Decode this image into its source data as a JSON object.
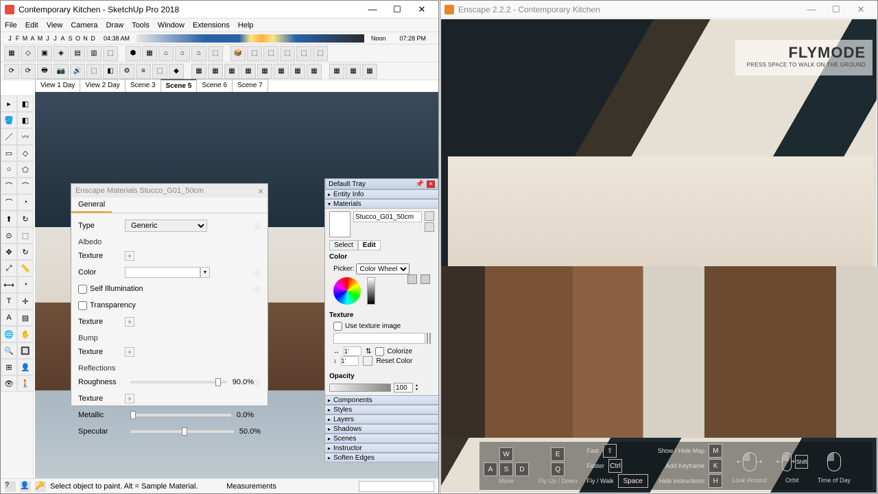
{
  "sketchup": {
    "title": "Contemporary Kitchen - SketchUp Pro 2018",
    "menu": [
      "File",
      "Edit",
      "View",
      "Camera",
      "Draw",
      "Tools",
      "Window",
      "Extensions",
      "Help"
    ],
    "months": [
      "J",
      "F",
      "M",
      "A",
      "M",
      "J",
      "J",
      "A",
      "S",
      "O",
      "N",
      "D"
    ],
    "time_04": "04:38 AM",
    "time_noon": "Noon",
    "time_pm": "07:28 PM",
    "scenes": {
      "list": [
        "View 1 Day",
        "View 2 Day",
        "Scene 3",
        "Scene 5",
        "Scene 6",
        "Scene 7"
      ],
      "active": "Scene 5"
    },
    "status_hint": "Select object to paint. Alt = Sample Material.",
    "measurements_label": "Measurements"
  },
  "enscape_mat": {
    "title": "Enscape Materials Stucco_G01_50cm",
    "tab": "General",
    "type_label": "Type",
    "type_value": "Generic",
    "albedo": "Albedo",
    "texture": "Texture",
    "color": "Color",
    "self_illum": "Self Illumination",
    "transparency": "Transparency",
    "bump": "Bump",
    "reflections": "Reflections",
    "roughness": "Roughness",
    "roughness_val": "90.0%",
    "metallic": "Metallic",
    "metallic_val": "0.0%",
    "specular": "Specular",
    "specular_val": "50.0%"
  },
  "tray": {
    "title": "Default Tray",
    "entity_info": "Entity Info",
    "materials": "Materials",
    "material_name": "Stucco_G01_50cm",
    "select": "Select",
    "edit": "Edit",
    "color": "Color",
    "picker_label": "Picker:",
    "picker_value": "Color Wheel",
    "texture": "Texture",
    "use_tex": "Use texture image",
    "colorize": "Colorize",
    "reset_color": "Reset Color",
    "opacity": "Opacity",
    "opacity_val": "100",
    "sections": [
      "Components",
      "Styles",
      "Layers",
      "Shadows",
      "Scenes",
      "Instructor",
      "Soften Edges"
    ]
  },
  "enscape_win": {
    "title": "Enscape 2.2.2 - Contemporary Kitchen",
    "flymode": "FLYMODE",
    "flymode_sub": "PRESS SPACE TO WALK ON THE GROUND",
    "hud": {
      "w": "W",
      "a": "A",
      "s": "S",
      "d": "D",
      "e": "E",
      "q": "Q",
      "move": "Move",
      "flyupdown": "Fly Up / Down",
      "fast": "Fast",
      "faster": "Faster",
      "flywalk": "Fly / Walk",
      "shift": "⇧",
      "ctrl": "Ctrl",
      "space": "Space",
      "showmap": "Show / Hide Map",
      "m": "M",
      "addkey": "Add Keyframe",
      "k": "K",
      "hideinstr": "Hide instructions",
      "h": "H",
      "lookaround": "Look Around",
      "orbit": "Orbit",
      "timeofday": "Time of Day",
      "shift2": "Shift"
    }
  }
}
